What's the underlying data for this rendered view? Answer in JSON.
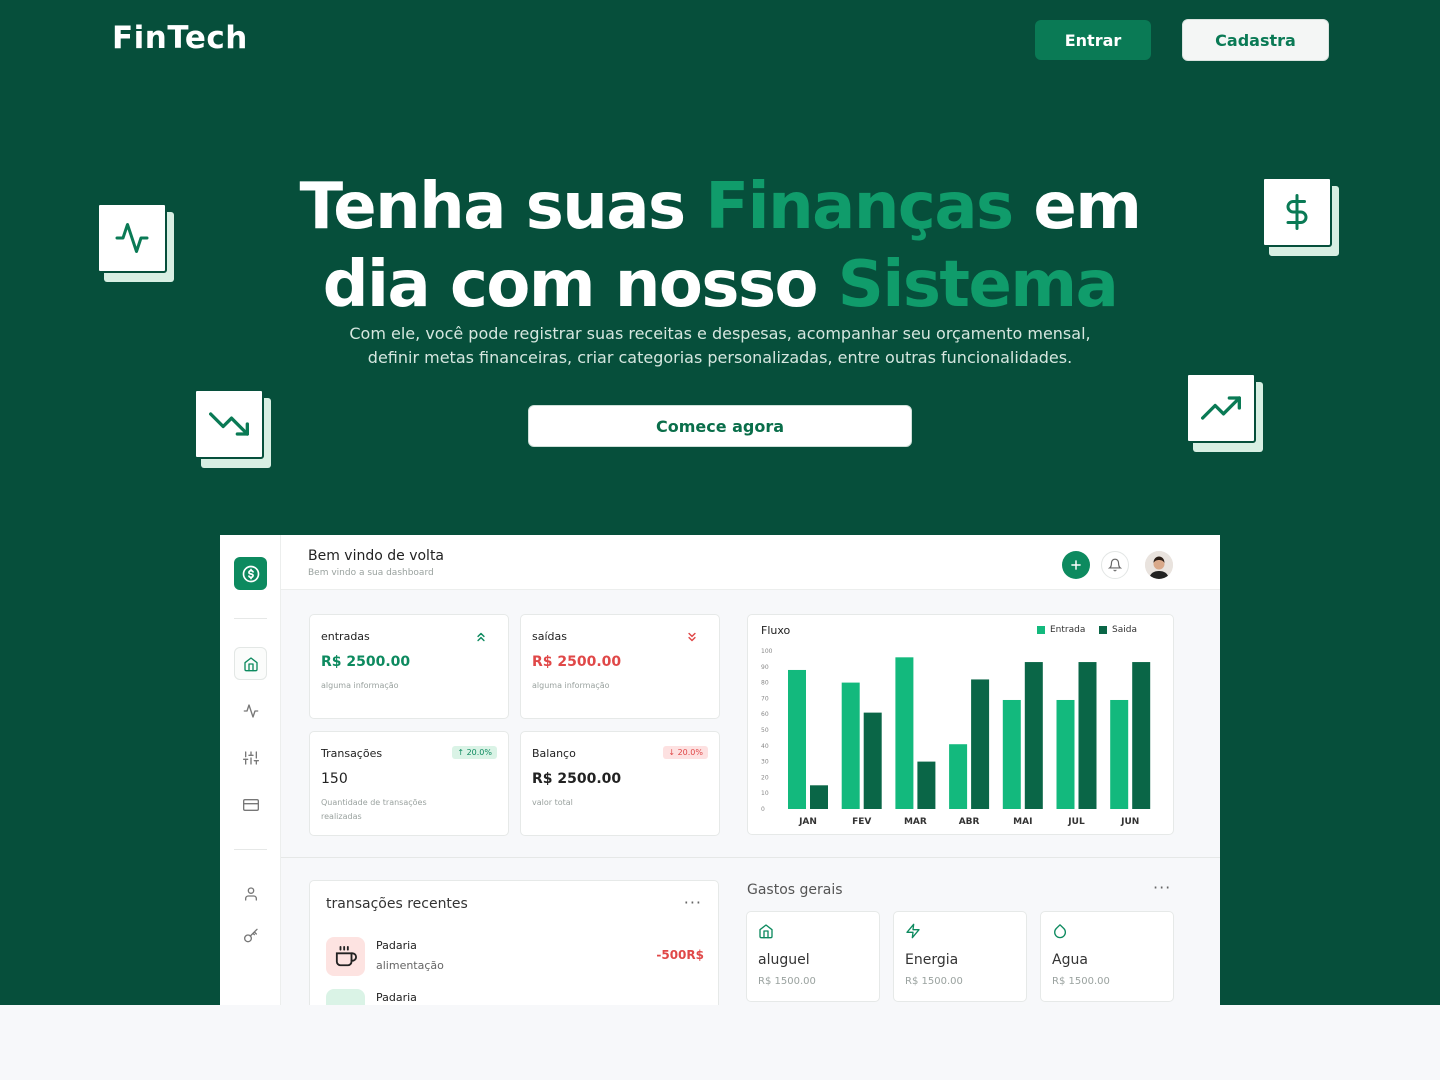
{
  "brand": "FinTech",
  "nav": {
    "login": "Entrar",
    "signup": "Cadastra"
  },
  "hero": {
    "line1_a": "Tenha suas ",
    "line1_b": "Finanças",
    "line1_c": " em",
    "line2_a": "dia com nosso ",
    "line2_b": "Sistema",
    "subtitle_1": "Com ele, você pode registrar suas receitas e despesas, acompanhar seu orçamento mensal,",
    "subtitle_2": "definir metas financeiras, criar categorias personalizadas, entre outras funcionalidades.",
    "cta": "Comece agora"
  },
  "floating_icons": [
    "activity-icon",
    "dollar-icon",
    "trending-down-icon",
    "trending-up-icon"
  ],
  "dashboard": {
    "welcome": "Bem vindo de volta",
    "welcome_sub": "Bem vindo a sua dashboard",
    "sidebar_icons": [
      "home-icon",
      "activity-icon",
      "sliders-icon",
      "credit-card-icon",
      "user-icon",
      "key-icon"
    ],
    "stats": {
      "entradas": {
        "label": "entradas",
        "value": "R$ 2500.00",
        "note": "alguma informação"
      },
      "saidas": {
        "label": "saídas",
        "value": "R$ 2500.00",
        "note": "alguma informação"
      },
      "transacoes": {
        "label": "Transações",
        "value": "150",
        "note": "Quantidade de transações realizadas",
        "badge": "↑ 20.0%"
      },
      "balanco": {
        "label": "Balanço",
        "value": "R$ 2500.00",
        "note": "valor total",
        "badge": "↓ 20.0%"
      }
    },
    "recent": {
      "title": "transações recentes",
      "items": [
        {
          "name": "Padaria",
          "category": "alimentação",
          "amount": "-500R$"
        },
        {
          "name": "Padaria",
          "category": "",
          "amount": ""
        }
      ]
    },
    "gastos": {
      "title": "Gastos gerais",
      "items": [
        {
          "name": "aluguel",
          "value": "R$ 1500.00",
          "icon": "home-icon"
        },
        {
          "name": "Energia",
          "value": "R$ 1500.00",
          "icon": "zap-icon"
        },
        {
          "name": "Agua",
          "value": "R$ 1500.00",
          "icon": "droplet-icon"
        }
      ]
    }
  },
  "colors": {
    "hero_bg": "#064f3b",
    "accent": "#109c6b",
    "entrada": "#13b97d",
    "saida": "#0a6647",
    "negative": "#e04848"
  },
  "chart_data": {
    "type": "bar",
    "title": "Fluxo",
    "categories": [
      "JAN",
      "FEV",
      "MAR",
      "ABR",
      "MAI",
      "JUL",
      "JUN"
    ],
    "series": [
      {
        "name": "Entrada",
        "values": [
          88,
          80,
          96,
          41,
          69,
          69,
          69
        ]
      },
      {
        "name": "Saida",
        "values": [
          15,
          61,
          30,
          82,
          93,
          93,
          93
        ]
      }
    ],
    "y_ticks": [
      100,
      90,
      80,
      70,
      60,
      50,
      40,
      30,
      20,
      10,
      0
    ],
    "ylim": [
      0,
      100
    ],
    "grid": false,
    "legend": "top-right"
  }
}
